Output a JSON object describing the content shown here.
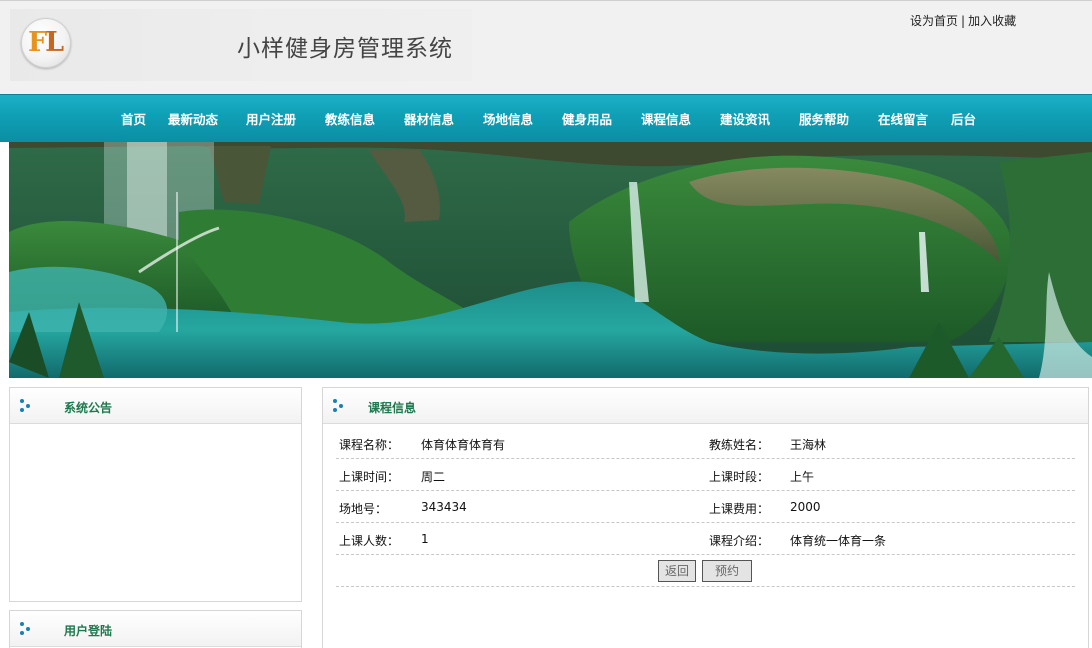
{
  "header": {
    "title": "小样健身房管理系统",
    "top_links": {
      "home": "设为首页",
      "separator": "|",
      "favorite": "加入收藏"
    }
  },
  "nav": {
    "items": [
      "首页",
      "最新动态",
      "用户注册",
      "教练信息",
      "器材信息",
      "场地信息",
      "健身用品",
      "课程信息",
      "建设资讯",
      "服务帮助",
      "在线留言",
      "后台"
    ]
  },
  "sidebar": {
    "announcement_title": "系统公告",
    "login_title": "用户登陆"
  },
  "course": {
    "panel_title": "课程信息",
    "rows": [
      {
        "label1": "课程名称：",
        "value1": "体育体育体育有",
        "label2": "教练姓名：",
        "value2": "王海林"
      },
      {
        "label1": "上课时间：",
        "value1": "周二",
        "label2": "上课时段：",
        "value2": "上午"
      },
      {
        "label1": "场地号：",
        "value1": "343434",
        "label2": "上课费用：",
        "value2": "2000"
      },
      {
        "label1": "上课人数：",
        "value1": "1",
        "label2": "课程介绍：",
        "value2": "体育统一体育一条"
      }
    ],
    "buttons": {
      "back": "返回",
      "reserve": "预约"
    }
  },
  "colors": {
    "nav": "#0f9fb5",
    "panel_title": "#1e7a4e",
    "dot": "#1a7fb3"
  },
  "icons": {
    "panel": "dots-icon",
    "logo": "logo-icon"
  }
}
